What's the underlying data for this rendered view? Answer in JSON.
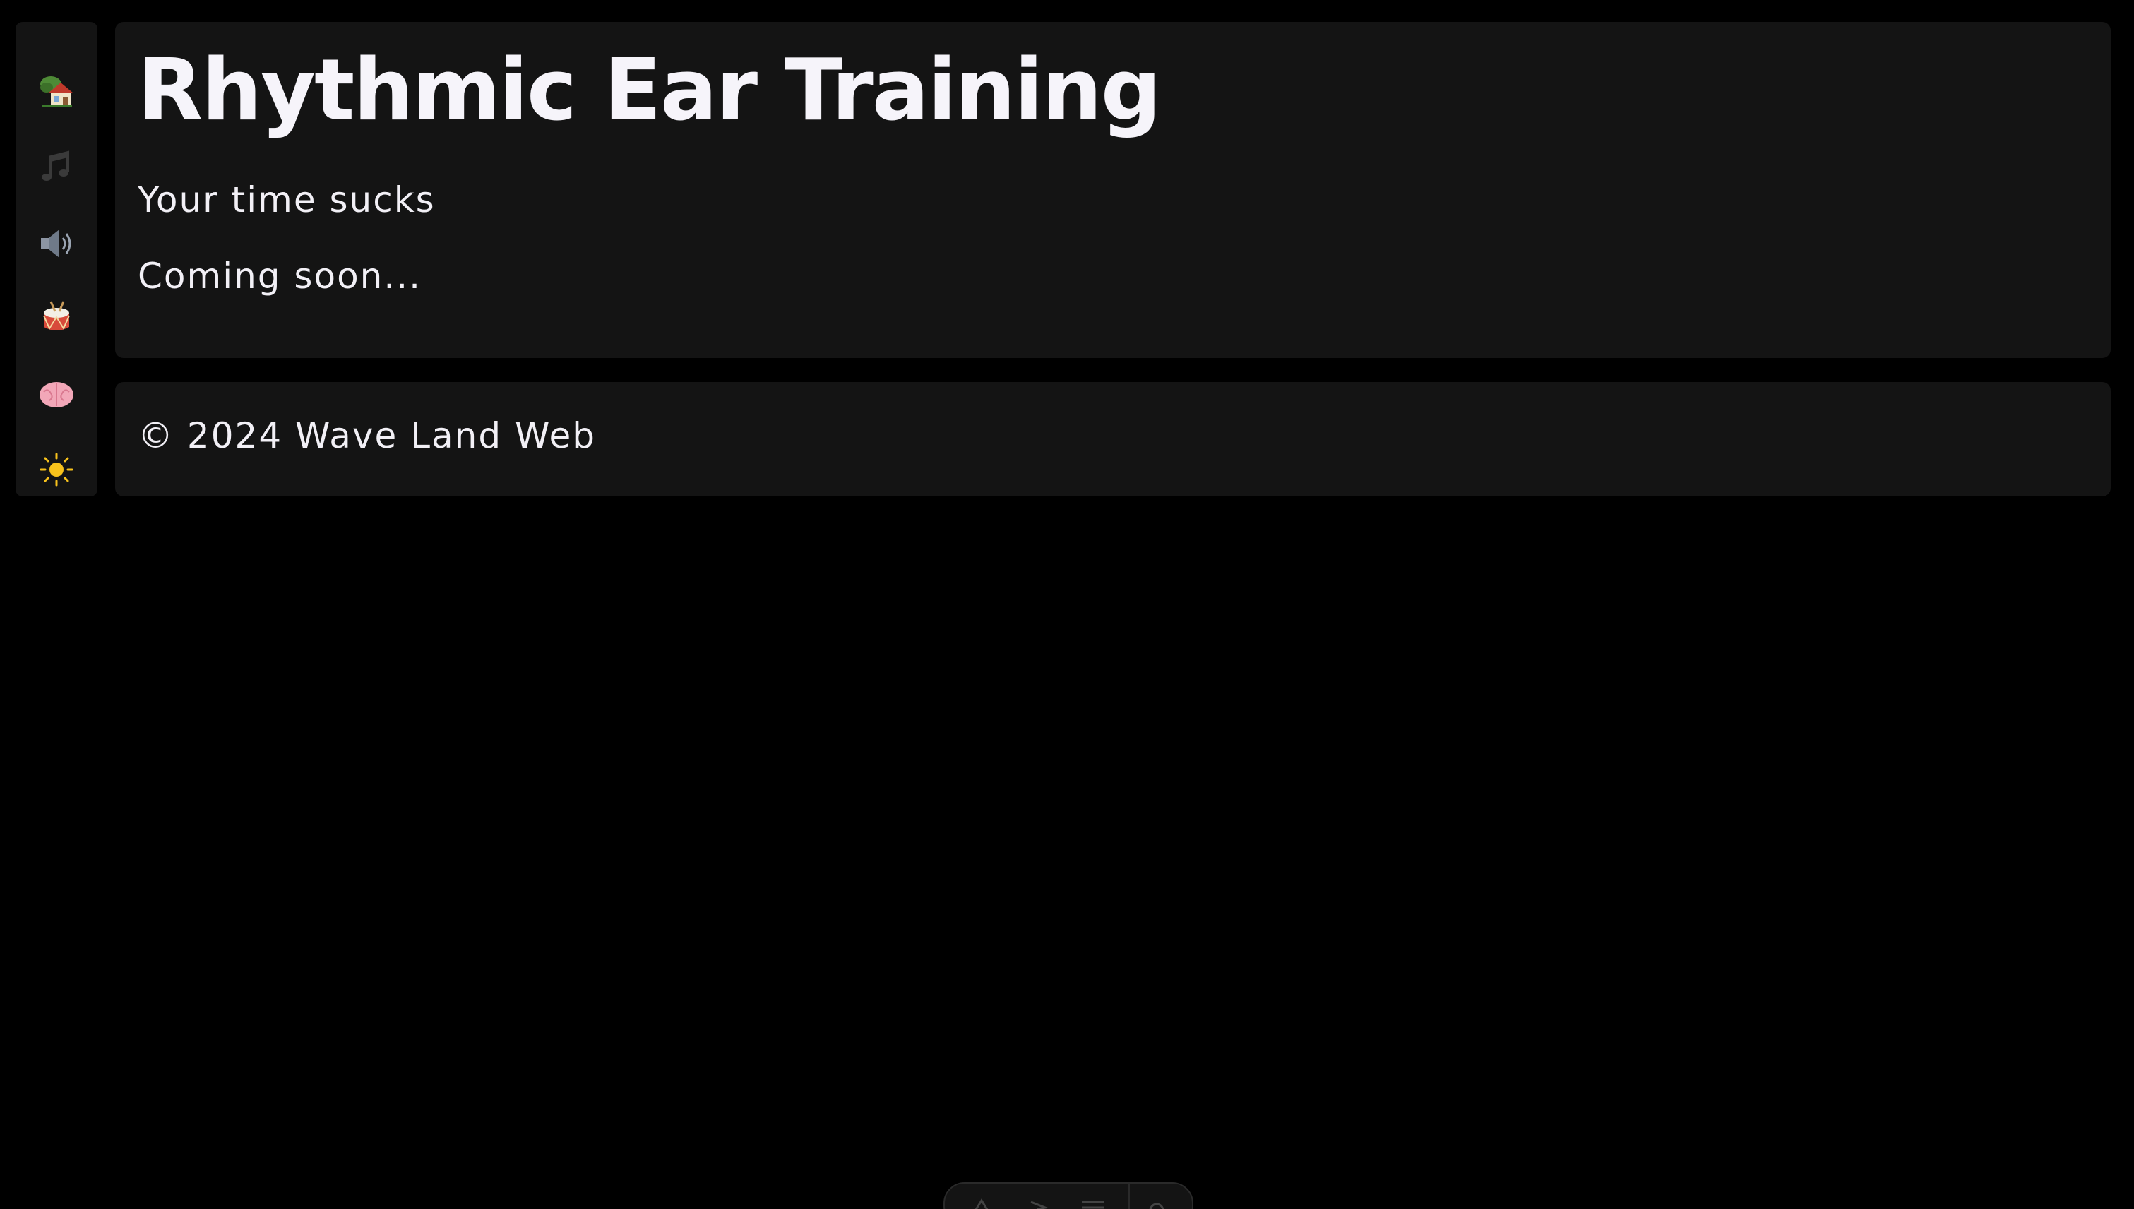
{
  "sidebar": {
    "items": [
      {
        "icon": "home-icon",
        "label": ""
      },
      {
        "icon": "music-notes-icon",
        "label": ""
      },
      {
        "icon": "speaker-icon",
        "label": ""
      },
      {
        "icon": "drum-icon",
        "label": ""
      },
      {
        "icon": "brain-icon",
        "label": ""
      },
      {
        "icon": "sun-icon",
        "label": ""
      }
    ]
  },
  "main": {
    "title": "Rhythmic Ear Training",
    "subtitle": "Your time sucks",
    "status": "Coming soon..."
  },
  "footer": {
    "copyright": "© 2024 Wave Land Web"
  },
  "colors": {
    "background": "#000000",
    "card": "#141414",
    "text": "#f4f2f8"
  }
}
